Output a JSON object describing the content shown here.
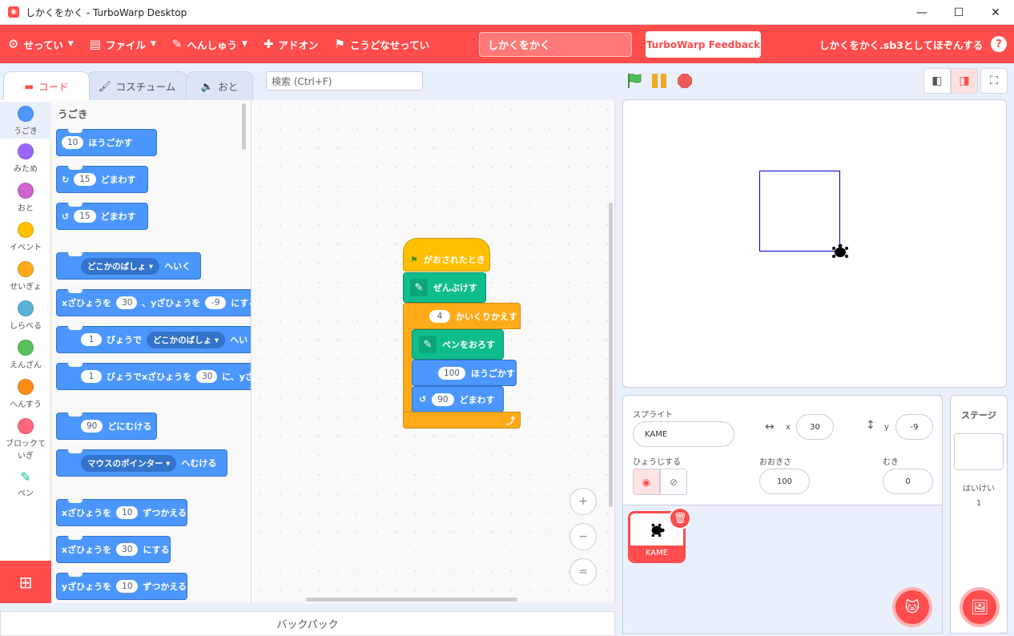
{
  "window": {
    "title": "しかくをかく - TurboWarp Desktop",
    "min": "—",
    "max": "☐",
    "close": "✕"
  },
  "menu": {
    "settings": "せってい",
    "file": "ファイル",
    "edit": "へんしゅう",
    "addons": "アドオン",
    "advanced": "こうどなせってい",
    "project_title": "しかくをかく",
    "feedback": "TurboWarp Feedback",
    "save_status": "しかくをかく.sb3としてほぞんする",
    "help": "?"
  },
  "tabs": {
    "code": "コード",
    "costumes": "コスチューム",
    "sounds": "おと"
  },
  "search": {
    "placeholder": "検索 (Ctrl+F)"
  },
  "categories": [
    {
      "label": "うごき",
      "color": "#4c97ff"
    },
    {
      "label": "みため",
      "color": "#9966ff"
    },
    {
      "label": "おと",
      "color": "#cf63cf"
    },
    {
      "label": "イベント",
      "color": "#ffbf00"
    },
    {
      "label": "せいぎょ",
      "color": "#ffab19"
    },
    {
      "label": "しらべる",
      "color": "#5cb1d6"
    },
    {
      "label": "えんざん",
      "color": "#59c059"
    },
    {
      "label": "へんすう",
      "color": "#ff8c1a"
    },
    {
      "label": "ブロックていぎ",
      "color": "#ff6680"
    },
    {
      "label": "ペン",
      "color": "#0fbd8c"
    }
  ],
  "palette": {
    "title": "うごき",
    "blocks": {
      "move": {
        "v": "10",
        "t": "ほうごかす"
      },
      "turn_right": {
        "v": "15",
        "t": "どまわす"
      },
      "turn_left": {
        "v": "15",
        "t": "どまわす"
      },
      "goto": {
        "dd": "どこかのばしょ",
        "t": "へいく"
      },
      "goto_xy": {
        "t1": "xざひょうを",
        "v1": "30",
        "t2": "、yざひょうを",
        "v2": "-9",
        "t3": "にする"
      },
      "glide": {
        "v": "1",
        "t1": "びょうで",
        "dd": "どこかのばしょ",
        "t2": "へい"
      },
      "glide_xy": {
        "v": "1",
        "t1": "びょうでxざひょうを",
        "v2": "30",
        "t2": "に、yざ"
      },
      "point_dir": {
        "v": "90",
        "t": "どにむける"
      },
      "point_towards": {
        "dd": "マウスのポインター",
        "t": "へむける"
      },
      "change_x": {
        "t1": "xざひょうを",
        "v": "10",
        "t2": "ずつかえる"
      },
      "set_x": {
        "t1": "xざひょうを",
        "v": "30",
        "t2": "にする"
      },
      "change_y": {
        "t1": "yざひょうを",
        "v": "10",
        "t2": "ずつかえる"
      }
    }
  },
  "script": {
    "hat": "がおされたとき",
    "clear": "ぜんぶけす",
    "repeat_n": "4",
    "repeat": "かいくりかえす",
    "pen_down": "ペンをおろす",
    "move_n": "100",
    "move": "ほうごかす",
    "turn_n": "90",
    "turn": "どまわす"
  },
  "zoom": {
    "in": "+",
    "out": "−",
    "reset": "="
  },
  "backpack": "バックパック",
  "sprite": {
    "label": "スプライト",
    "name": "KAME",
    "x_label": "x",
    "x": "30",
    "y_label": "y",
    "y": "-9",
    "show_label": "ひょうじする",
    "size_label": "おおきさ",
    "size": "100",
    "direction_label": "むき",
    "direction": "0"
  },
  "sprites": [
    {
      "name": "KAME"
    }
  ],
  "stage_panel": {
    "title": "ステージ",
    "backdrops_label": "はいけい",
    "backdrops_count": "1"
  }
}
